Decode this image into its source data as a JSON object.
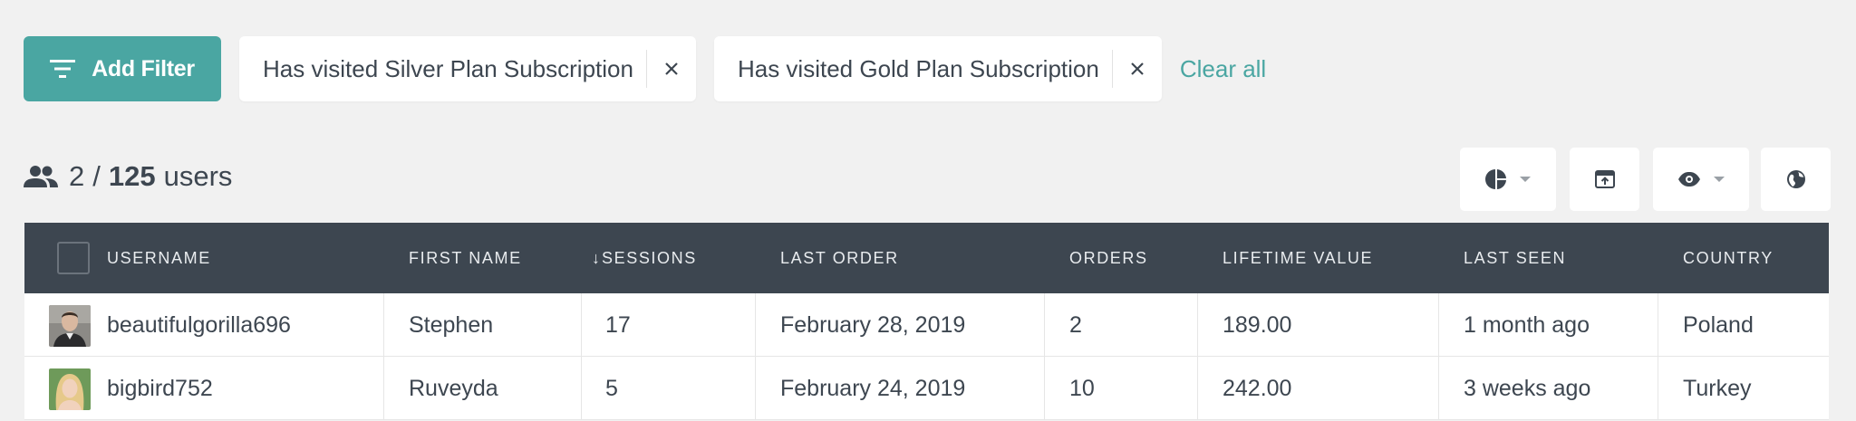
{
  "filters": {
    "add_label": "Add Filter",
    "chips": [
      {
        "label": "Has visited Silver Plan Subscription"
      },
      {
        "label": "Has visited Gold Plan Subscription"
      }
    ],
    "clear_all": "Clear all"
  },
  "summary": {
    "shown": "2",
    "separator": "/",
    "total": "125",
    "unit": "users"
  },
  "toolbar": {
    "buttons": [
      "chart-pie-icon",
      "export-icon",
      "eye-icon",
      "globe-icon"
    ]
  },
  "table": {
    "headers": {
      "username": "USERNAME",
      "first_name": "FIRST NAME",
      "sessions": "SESSIONS",
      "sessions_sort": "↓",
      "last_order": "LAST ORDER",
      "orders": "ORDERS",
      "lifetime_value": "LIFETIME VALUE",
      "last_seen": "LAST SEEN",
      "country": "COUNTRY"
    },
    "rows": [
      {
        "username": "beautifulgorilla696",
        "first_name": "Stephen",
        "sessions": "17",
        "last_order": "February 28, 2019",
        "orders": "2",
        "lifetime_value": "189.00",
        "last_seen": "1 month ago",
        "country": "Poland"
      },
      {
        "username": "bigbird752",
        "first_name": "Ruveyda",
        "sessions": "5",
        "last_order": "February 24, 2019",
        "orders": "10",
        "lifetime_value": "242.00",
        "last_seen": "3 weeks ago",
        "country": "Turkey"
      }
    ]
  },
  "colors": {
    "accent": "#4aa6a2",
    "header_bg": "#3d4650",
    "page_bg": "#f1f1f1"
  }
}
